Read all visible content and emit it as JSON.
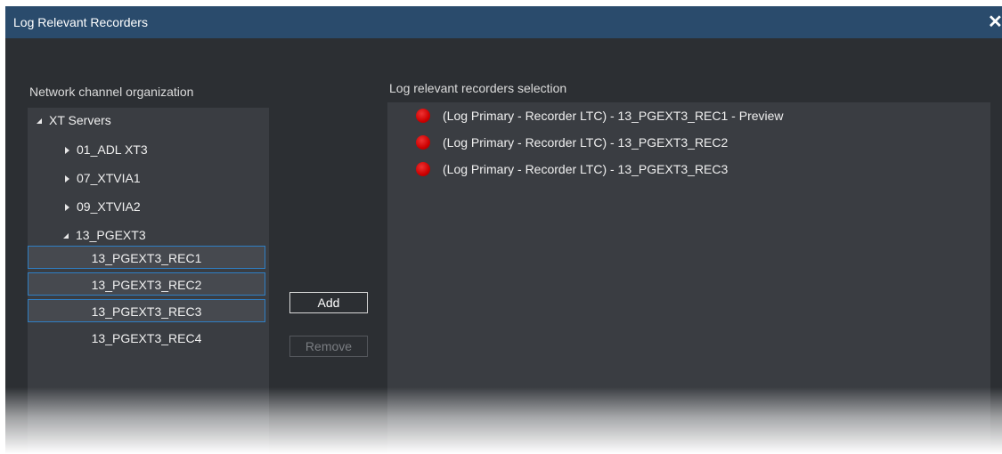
{
  "window": {
    "title": "Log Relevant Recorders",
    "close_label": "✕"
  },
  "left": {
    "label": "Network channel organization",
    "tree": {
      "root": "XT Servers",
      "servers": [
        {
          "label": "01_ADL XT3",
          "expanded": false
        },
        {
          "label": "07_XTVIA1",
          "expanded": false
        },
        {
          "label": "09_XTVIA2",
          "expanded": false
        },
        {
          "label": "13_PGEXT3",
          "expanded": true
        }
      ],
      "recorders": [
        {
          "label": "13_PGEXT3_REC1",
          "selected": true
        },
        {
          "label": "13_PGEXT3_REC2",
          "selected": true
        },
        {
          "label": "13_PGEXT3_REC3",
          "selected": true
        },
        {
          "label": "13_PGEXT3_REC4",
          "selected": false
        }
      ]
    }
  },
  "buttons": {
    "add": "Add",
    "remove": "Remove"
  },
  "right": {
    "label": "Log relevant recorders selection",
    "items": [
      {
        "label": "(Log Primary - Recorder LTC) - 13_PGEXT3_REC1 - Preview",
        "status_color": "#cc0000"
      },
      {
        "label": "(Log Primary - Recorder LTC) - 13_PGEXT3_REC2",
        "status_color": "#cc0000"
      },
      {
        "label": "(Log Primary - Recorder LTC) - 13_PGEXT3_REC3",
        "status_color": "#cc0000"
      }
    ]
  },
  "colors": {
    "titlebar": "#2a4b6c",
    "background": "#2c2f33",
    "panel": "#3a3d42",
    "selection_border": "#2f7fc4"
  }
}
